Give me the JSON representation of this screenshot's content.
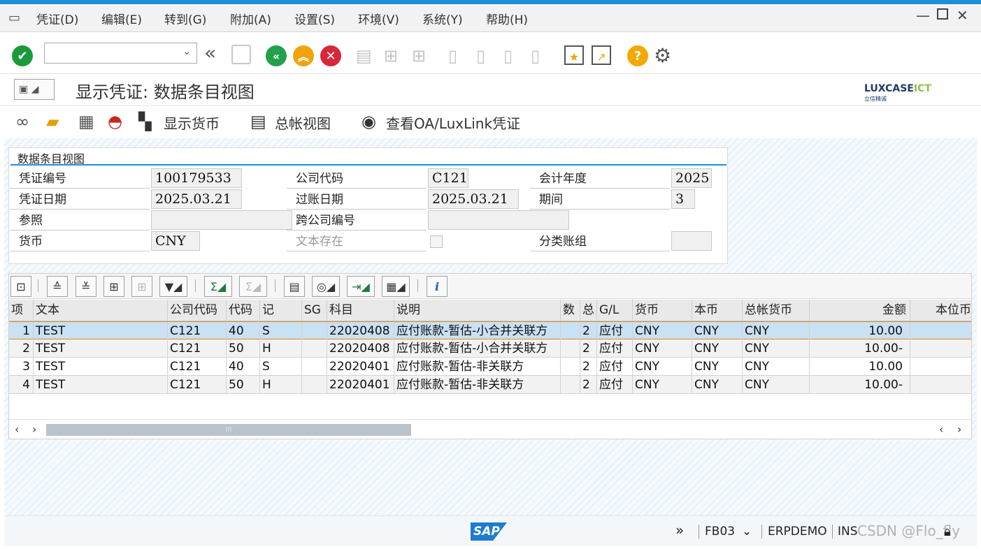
{
  "menu": {
    "items": [
      "凭证(D)",
      "编辑(E)",
      "转到(G)",
      "附加(A)",
      "设置(S)",
      "环境(V)",
      "系统(Y)",
      "帮助(H)"
    ]
  },
  "toolbar": {
    "command_value": ""
  },
  "screen": {
    "title": "显示凭证: 数据条目视图",
    "logo_text": "LUXCASE",
    "logo_accent": "ICT",
    "logo_sub": "立信精诚"
  },
  "app_toolbar": {
    "show_currency": "显示货币",
    "gl_view": "总帐视图",
    "view_oa": "查看OA/LuxLink凭证"
  },
  "header": {
    "section_title": "数据条目视图",
    "doc_no_label": "凭证编号",
    "doc_no": "100179533",
    "company_label": "公司代码",
    "company": "C121",
    "fiscal_year_label": "会计年度",
    "fiscal_year": "2025",
    "doc_date_label": "凭证日期",
    "doc_date": "2025.03.21",
    "posting_date_label": "过账日期",
    "posting_date": "2025.03.21",
    "period_label": "期间",
    "period": "3",
    "reference_label": "参照",
    "reference": "",
    "cross_company_label": "跨公司编号",
    "cross_company": "",
    "currency_label": "货币",
    "currency": "CNY",
    "text_exists_label": "文本存在",
    "ledger_group_label": "分类账组",
    "ledger_group": ""
  },
  "grid": {
    "columns": [
      "项",
      "文本",
      "公司代码",
      "代码",
      "记",
      "SG",
      "科目",
      "说明",
      "数",
      "总",
      "G/L",
      "货币",
      "本币",
      "总帐货币",
      "金额",
      "本位币"
    ],
    "rows": [
      [
        "1",
        "TEST",
        "C121",
        "40",
        "S",
        "",
        "22020408",
        "应付账款-暂估-小合并关联方",
        "",
        "2",
        "应付",
        "CNY",
        "CNY",
        "CNY",
        "10.00",
        ""
      ],
      [
        "2",
        "TEST",
        "C121",
        "50",
        "H",
        "",
        "22020408",
        "应付账款-暂估-小合并关联方",
        "",
        "2",
        "应付",
        "CNY",
        "CNY",
        "CNY",
        "10.00-",
        ""
      ],
      [
        "3",
        "TEST",
        "C121",
        "40",
        "S",
        "",
        "22020401",
        "应付账款-暂估-非关联方",
        "",
        "2",
        "应付",
        "CNY",
        "CNY",
        "CNY",
        "10.00",
        ""
      ],
      [
        "4",
        "TEST",
        "C121",
        "50",
        "H",
        "",
        "22020401",
        "应付账款-暂估-非关联方",
        "",
        "2",
        "应付",
        "CNY",
        "CNY",
        "CNY",
        "10.00-",
        ""
      ]
    ],
    "scroll_grip": "⁝⁝⁝"
  },
  "status": {
    "tcode": "FB03",
    "system": "ERPDEMO",
    "mode": "INS",
    "watermark": "CSDN @Flo_fly",
    "sap_logo": "SAP"
  },
  "colors": {
    "accent": "#1e8fd6",
    "selected_row": "#c9e1f2",
    "ok_green": "#1a9a3a",
    "back_green": "#22a04b",
    "exit_orange": "#f0a30a",
    "cancel_red": "#d9263a",
    "help_orange": "#f2a900"
  }
}
